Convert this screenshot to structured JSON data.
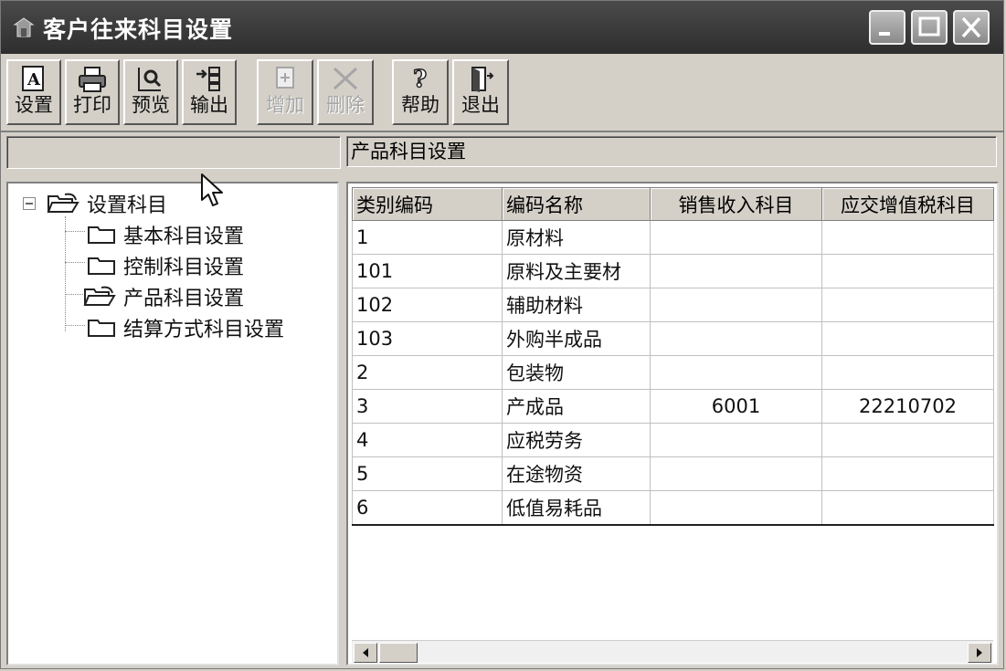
{
  "window": {
    "title": "客户往来科目设置"
  },
  "toolbar": {
    "settings": "设置",
    "print": "打印",
    "preview": "预览",
    "export": "输出",
    "add": "增加",
    "delete": "删除",
    "help": "帮助",
    "exit": "退出"
  },
  "header": {
    "section_title": "产品科目设置"
  },
  "tree": {
    "root": "设置科目",
    "items": [
      "基本科目设置",
      "控制科目设置",
      "产品科目设置",
      "结算方式科目设置"
    ]
  },
  "table": {
    "columns": [
      "类别编码",
      "编码名称",
      "销售收入科目",
      "应交增值税科目"
    ],
    "rows": [
      [
        "1",
        "原材料",
        "",
        ""
      ],
      [
        "101",
        "原料及主要材",
        "",
        ""
      ],
      [
        "102",
        "辅助材料",
        "",
        ""
      ],
      [
        "103",
        "外购半成品",
        "",
        ""
      ],
      [
        "2",
        "包装物",
        "",
        ""
      ],
      [
        "3",
        "产成品",
        "6001",
        "22210702"
      ],
      [
        "4",
        "应税劳务",
        "",
        ""
      ],
      [
        "5",
        "在途物资",
        "",
        ""
      ],
      [
        "6",
        "低值易耗品",
        "",
        ""
      ]
    ]
  }
}
